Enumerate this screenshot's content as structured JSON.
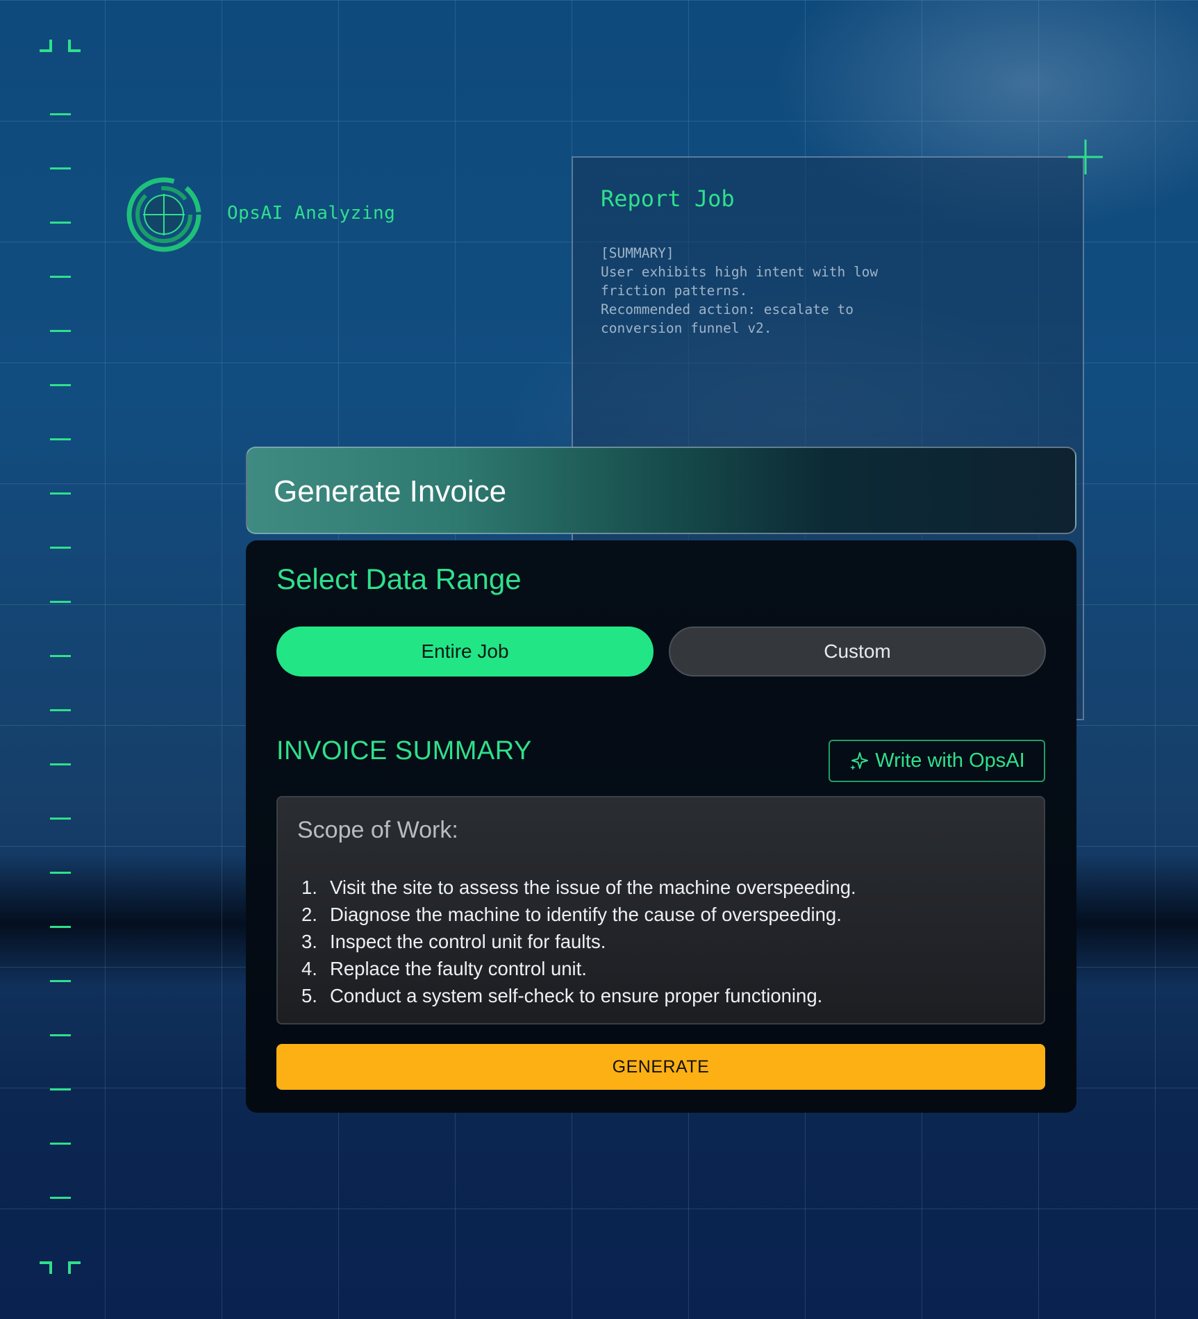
{
  "status": {
    "ai_label": "OpsAI Analyzing",
    "icon": "crosshair-radar-icon"
  },
  "report": {
    "title": "Report Job",
    "body": "[SUMMARY]\nUser exhibits high intent with low\nfriction patterns.\nRecommended action: escalate to\nconversion funnel v2."
  },
  "invoice": {
    "header_title": "Generate Invoice",
    "range_title": "Select Data Range",
    "range_options": [
      {
        "label": "Entire Job",
        "selected": true
      },
      {
        "label": "Custom",
        "selected": false
      }
    ],
    "summary_title": "INVOICE SUMMARY",
    "write_button": "Write with OpsAI",
    "write_icon": "sparkle-icon",
    "scope_label": "Scope of Work:",
    "scope_items": [
      {
        "num": "1.",
        "text": "Visit the site to assess the issue of the machine overspeeding."
      },
      {
        "num": "2.",
        "text": "Diagnose the machine to identify the cause of overspeeding."
      },
      {
        "num": "3.",
        "text": "Inspect the control unit for faults."
      },
      {
        "num": "4.",
        "text": "Replace the faulty control unit."
      },
      {
        "num": "5.",
        "text": "Conduct a system self-check to ensure proper functioning."
      }
    ],
    "generate_button": "GENERATE"
  },
  "colors": {
    "accent_green": "#2fe08c",
    "selected_green": "#22e686",
    "generate_orange": "#fdb013",
    "background_blue": "#124d80"
  }
}
